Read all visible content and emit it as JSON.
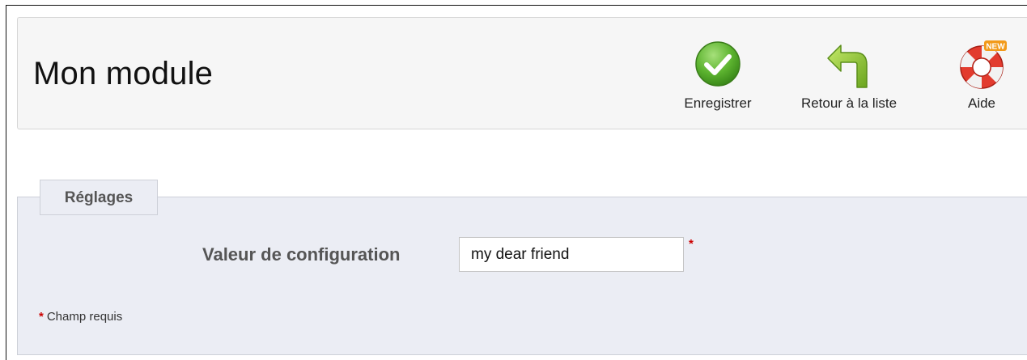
{
  "header": {
    "title": "Mon module",
    "toolbar": {
      "save_label": "Enregistrer",
      "back_label": "Retour à la liste",
      "help_label": "Aide",
      "help_badge": "NEW"
    }
  },
  "form": {
    "legend": "Réglages",
    "field_label": "Valeur de configuration",
    "field_value": "my dear friend",
    "required_marker": "*",
    "required_note": "Champ requis"
  },
  "colors": {
    "save_green": "#5cb85c",
    "back_green": "#86c13a",
    "help_red": "#e23b2e",
    "required_red": "#cc0000"
  },
  "icons": {
    "save": "check-circle-icon",
    "back": "return-arrow-icon",
    "help": "lifebuoy-icon"
  }
}
